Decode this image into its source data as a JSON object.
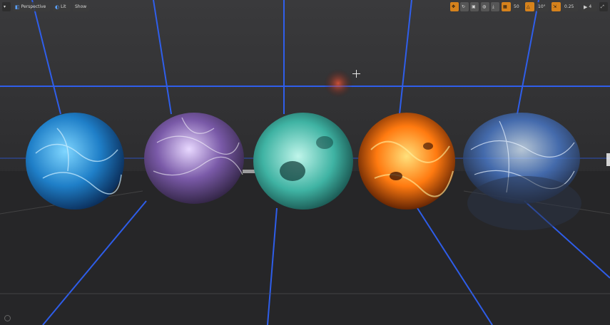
{
  "toolbar": {
    "left": {
      "menu_icon": "dropdown-menu-icon",
      "perspective_label": "Perspective",
      "lit_label": "Lit",
      "show_label": "Show"
    },
    "right": {
      "translate_icon": "translate-mode-icon",
      "rotate_icon": "rotate-mode-icon",
      "scale_icon": "scale-mode-icon",
      "world_icon": "world-space-icon",
      "grid_snap_icon": "grid-snap-icon",
      "grid_snap_value": "50",
      "rotation_snap_icon": "rotation-snap-icon",
      "rotation_snap_value": "10°",
      "scale_snap_icon": "scale-snap-icon",
      "scale_snap_value": "0.25",
      "camera_speed_icon": "camera-speed-icon",
      "camera_speed_value": "4"
    }
  },
  "scene": {
    "spheres": [
      {
        "name": "blue-electric-sphere",
        "colors": [
          "#7fd6ff",
          "#1f7fc8",
          "#0a2a55"
        ]
      },
      {
        "name": "purple-crystal-sphere",
        "colors": [
          "#e8d8ff",
          "#7a5aa8",
          "#2a1f3a"
        ]
      },
      {
        "name": "teal-plasma-sphere",
        "colors": [
          "#bff5ea",
          "#3fb3a3",
          "#0f3a38"
        ]
      },
      {
        "name": "fire-sphere",
        "colors": [
          "#ffe07a",
          "#ff7a10",
          "#3a0d00"
        ]
      },
      {
        "name": "hologram-sphere",
        "colors": [
          "#d9ecff",
          "#4a7acb",
          "#1a2235"
        ]
      }
    ],
    "grid_color": "#2f64ff"
  }
}
